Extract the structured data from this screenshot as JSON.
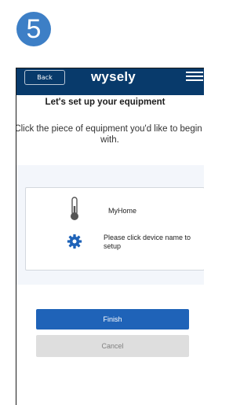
{
  "step": {
    "number": "5",
    "color": "#3d7fc6"
  },
  "appbar": {
    "back_label": "Back",
    "brand": "wysely",
    "menu_icon": "hamburger-menu-icon",
    "background": "#083a6b"
  },
  "setup": {
    "heading": "Let's set up your equipment",
    "instruction_line1": "Click the piece of equipment you'd like to begin",
    "instruction_line2": "with."
  },
  "device": {
    "name": "MyHome",
    "name_icon": "thermometer-icon",
    "hint": "Please click device name to setup",
    "hint_icon": "gear-icon",
    "icon_color": "#1f63b8"
  },
  "actions": {
    "finish_label": "Finish",
    "cancel_label": "Cancel",
    "primary_color": "#1f63b8"
  }
}
